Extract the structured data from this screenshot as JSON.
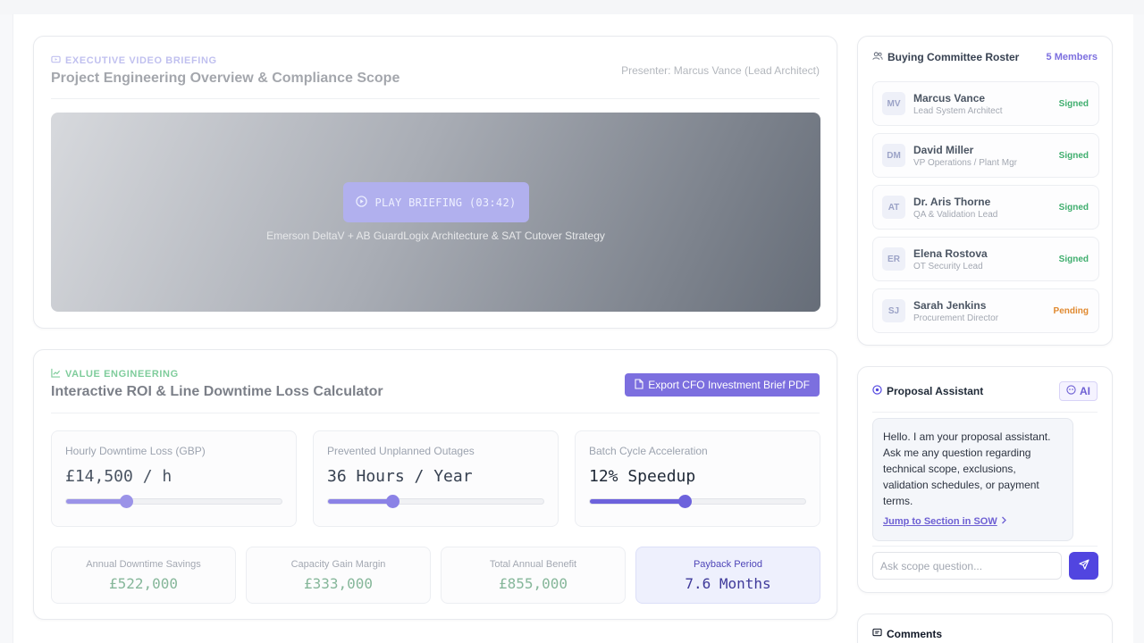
{
  "colors": {
    "accent": "#5145e0",
    "accent_soft": "#7c6fdf",
    "success": "#3fae6e",
    "warning": "#e0892f"
  },
  "video": {
    "eyebrow": "EXECUTIVE VIDEO BRIEFING",
    "title": "Project Engineering Overview & Compliance Scope",
    "presenter": "Presenter: Marcus Vance (Lead Architect)",
    "play_label": "PLAY BRIEFING (03:42)",
    "caption": "Emerson DeltaV + AB GuardLogix Architecture & SAT Cutover Strategy"
  },
  "roi": {
    "eyebrow": "VALUE ENGINEERING",
    "title": "Interactive ROI & Line Downtime Loss Calculator",
    "export_label": "Export CFO Investment Brief PDF",
    "sliders": [
      {
        "label": "Hourly Downtime Loss (GBP)",
        "value": "£14,500 / h",
        "level": 0.28,
        "color": "#9b93e8",
        "text_color": "#4b5563"
      },
      {
        "label": "Prevented Unplanned Outages",
        "value": "36 Hours / Year",
        "level": 0.3,
        "color": "#8b82e6",
        "text_color": "#374151"
      },
      {
        "label": "Batch Cycle Acceleration",
        "value": "12% Speedup",
        "level": 0.44,
        "color": "#6d62dc",
        "text_color": "#1f2937"
      }
    ],
    "metrics": [
      {
        "label": "Annual Downtime Savings",
        "value": "£522,000"
      },
      {
        "label": "Capacity Gain Margin",
        "value": "£333,000"
      },
      {
        "label": "Total Annual Benefit",
        "value": "£855,000"
      },
      {
        "label": "Payback Period",
        "value": "7.6 Months"
      }
    ]
  },
  "roster": {
    "title": "Buying Committee Roster",
    "count": "5 Members",
    "members": [
      {
        "initials": "MV",
        "name": "Marcus Vance",
        "role": "Lead System Architect",
        "status": "Signed"
      },
      {
        "initials": "DM",
        "name": "David Miller",
        "role": "VP Operations / Plant Mgr",
        "status": "Signed"
      },
      {
        "initials": "AT",
        "name": "Dr. Aris Thorne",
        "role": "QA & Validation Lead",
        "status": "Signed"
      },
      {
        "initials": "ER",
        "name": "Elena Rostova",
        "role": "OT Security Lead",
        "status": "Signed"
      },
      {
        "initials": "SJ",
        "name": "Sarah Jenkins",
        "role": "Procurement Director",
        "status": "Pending"
      }
    ]
  },
  "assistant": {
    "title": "Proposal Assistant",
    "badge": "AI",
    "message": "Hello. I am your proposal assistant. Ask me any question regarding technical scope, exclusions, validation schedules, or payment terms.",
    "link_label": "Jump to Section in SOW",
    "input_placeholder": "Ask scope question..."
  },
  "comments": {
    "title": "Comments"
  }
}
